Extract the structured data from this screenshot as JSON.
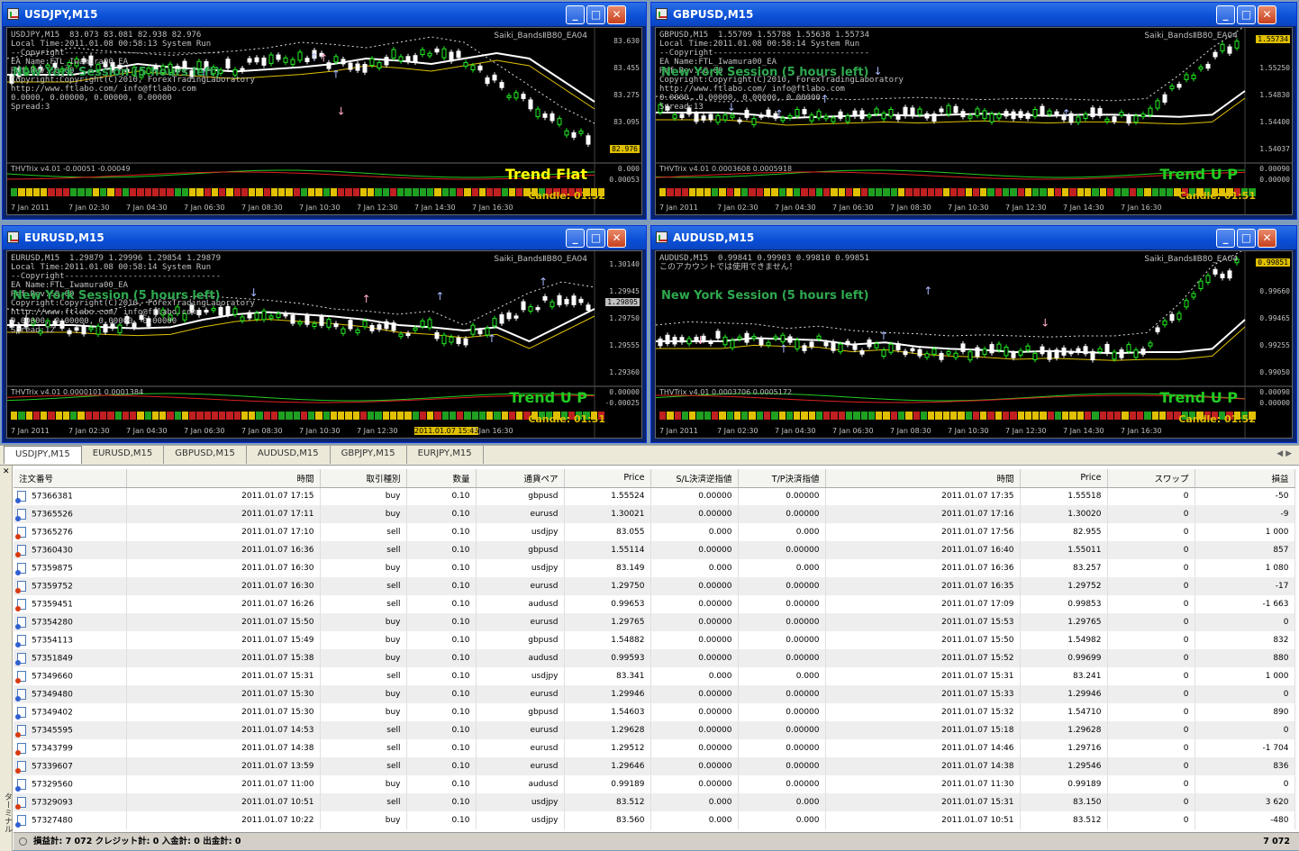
{
  "windows": [
    {
      "title": "USDJPY,M15",
      "info_lines": [
        "USDJPY,M15  83.073 83.081 82.938 82.976",
        "Local Time:2011.01.08 00:58:13 System Run",
        "--Copyright--------------------------------",
        "EA Name:FTL_Iwamura00_EA",
        "Ref.Rev.:0.00",
        "Copyright:Copyright(C)2010, ForexTradingLaboratory",
        "http://www.ftlabo.com/ info@ftlabo.com",
        "",
        "0.0000, 0.00000, 0.00000, 0.00000",
        "Spread:3"
      ],
      "ea_label": "Saiki_BandsⅡB80_EA04",
      "session": "New York Session (5 hours left)",
      "trend": "Trend Flat",
      "trend_up": false,
      "candle": "Candle:  01:52",
      "prices": [
        "83.630",
        "83.455",
        "83.275",
        "83.095",
        "82.920"
      ],
      "current_price": "82.976",
      "indicator": "THVTrix v4.01 -0.00051 -0.00049",
      "ind_values": [
        "0.000",
        "0.00053"
      ],
      "xaxis": [
        "7 Jan 2011",
        "7 Jan 02:30",
        "7 Jan 04:30",
        "7 Jan 06:30",
        "7 Jan 08:30",
        "7 Jan 10:30",
        "7 Jan 12:30",
        "7 Jan 14:30",
        "7 Jan 16:30"
      ]
    },
    {
      "title": "GBPUSD,M15",
      "info_lines": [
        "GBPUSD,M15  1.55709 1.55788 1.55638 1.55734",
        "Local Time:2011.01.08 00:58:14 System Run",
        "--Copyright--------------------------------",
        "EA Name:FTL_Iwamura00_EA",
        "Ref.Rev.:0.00",
        "Copyright:Copyright(C)2010, ForexTradingLaboratory",
        "http://www.ftlabo.com/ info@ftlabo.com",
        "",
        "0.0000, 0.00000, 0.00000, 0.00000",
        "Spread:13"
      ],
      "ea_label": "Saiki_BandsⅡB80_EA04",
      "session": "New York Session (5 hours left)",
      "trend": "Trend U P",
      "trend_up": true,
      "candle": "Candle:  01:51",
      "prices": [
        "1.55734",
        "1.55250",
        "1.54830",
        "1.54400",
        "1.54037"
      ],
      "current_price": "1.55734",
      "indicator": "THVTrix v4.01 0.0003608 0.0005918",
      "ind_values": [
        "0.00090",
        "0.00000"
      ],
      "xaxis": [
        "7 Jan 2011",
        "7 Jan 02:30",
        "7 Jan 04:30",
        "7 Jan 06:30",
        "7 Jan 08:30",
        "7 Jan 10:30",
        "7 Jan 12:30",
        "7 Jan 14:30",
        "7 Jan 16:30"
      ]
    },
    {
      "title": "EURUSD,M15",
      "info_lines": [
        "EURUSD,M15  1.29879 1.29996 1.29854 1.29879",
        "Local Time:2011.01.08 00:58:14 System Run",
        "--Copyright--------------------------------",
        "EA Name:FTL_Iwamura00_EA",
        "Ref.Rev.:0.00",
        "Copyright:Copyright(C)2010, ForexTradingLaboratory",
        "http://www.ftlabo.com/ info@ftlabo.com",
        "",
        "0.00000, 0.00000, 0.00000, 0.00000",
        "Spread:12"
      ],
      "ea_label": "Saiki_BandsⅡB80_EA04",
      "session": "New York Session (5 hours left)",
      "trend": "Trend U P",
      "trend_up": true,
      "candle": "Candle:  01:51",
      "prices": [
        "1.30140",
        "1.29945",
        "1.29750",
        "1.29555",
        "1.29360"
      ],
      "current_price": "1.29895",
      "indicator": "THVTrix v4.01 0.0000101 0.0001384",
      "ind_values": [
        "0.00000",
        "-0.00025"
      ],
      "xaxis": [
        "7 Jan 2011",
        "7 Jan 02:30",
        "7 Jan 04:30",
        "7 Jan 06:30",
        "7 Jan 08:30",
        "7 Jan 10:30",
        "7 Jan 12:30",
        "2011.01.07 15:45",
        "7 Jan 16:30"
      ]
    },
    {
      "title": "AUDUSD,M15",
      "info_lines": [
        "AUDUSD,M15  0.99841 0.99903 0.99810 0.99851",
        "このアカウントでは使用できません！"
      ],
      "ea_label": "Saiki_BandsⅡB80_EA04",
      "session": "New York Session (5 hours left)",
      "trend": "Trend U P",
      "trend_up": true,
      "candle": "Candle:  01:52",
      "prices": [
        "0.99851",
        "0.99660",
        "0.99465",
        "0.99255",
        "0.99050"
      ],
      "current_price": "0.99851",
      "indicator": "THVTrix v4.01 0.0003706 0.0005172",
      "ind_values": [
        "0.00090",
        "0.00000"
      ],
      "xaxis": [
        "7 Jan 2011",
        "7 Jan 02:30",
        "7 Jan 04:30",
        "7 Jan 06:30",
        "7 Jan 08:30",
        "7 Jan 10:30",
        "7 Jan 12:30",
        "7 Jan 14:30",
        "7 Jan 16:30"
      ]
    }
  ],
  "chart_tabs": [
    "USDJPY,M15",
    "EURUSD,M15",
    "GBPUSD,M15",
    "AUDUSD,M15",
    "GBPJPY,M15",
    "EURJPY,M15"
  ],
  "active_tab": "USDJPY,M15",
  "columns": [
    "注文番号",
    "時間",
    "取引種別",
    "数量",
    "通貨ペア",
    "Price",
    "S/L決済逆指値",
    "T/P決済指値",
    "時間",
    "Price",
    "スワップ",
    "損益"
  ],
  "rows": [
    [
      "57366381",
      "2011.01.07 17:15",
      "buy",
      "0.10",
      "gbpusd",
      "1.55524",
      "0.00000",
      "0.00000",
      "2011.01.07 17:35",
      "1.55518",
      "0",
      "-50"
    ],
    [
      "57365526",
      "2011.01.07 17:11",
      "buy",
      "0.10",
      "eurusd",
      "1.30021",
      "0.00000",
      "0.00000",
      "2011.01.07 17:16",
      "1.30020",
      "0",
      "-9"
    ],
    [
      "57365276",
      "2011.01.07 17:10",
      "sell",
      "0.10",
      "usdjpy",
      "83.055",
      "0.000",
      "0.000",
      "2011.01.07 17:56",
      "82.955",
      "0",
      "1 000"
    ],
    [
      "57360430",
      "2011.01.07 16:36",
      "sell",
      "0.10",
      "gbpusd",
      "1.55114",
      "0.00000",
      "0.00000",
      "2011.01.07 16:40",
      "1.55011",
      "0",
      "857"
    ],
    [
      "57359875",
      "2011.01.07 16:30",
      "buy",
      "0.10",
      "usdjpy",
      "83.149",
      "0.000",
      "0.000",
      "2011.01.07 16:36",
      "83.257",
      "0",
      "1 080"
    ],
    [
      "57359752",
      "2011.01.07 16:30",
      "sell",
      "0.10",
      "eurusd",
      "1.29750",
      "0.00000",
      "0.00000",
      "2011.01.07 16:35",
      "1.29752",
      "0",
      "-17"
    ],
    [
      "57359451",
      "2011.01.07 16:26",
      "sell",
      "0.10",
      "audusd",
      "0.99653",
      "0.00000",
      "0.00000",
      "2011.01.07 17:09",
      "0.99853",
      "0",
      "-1 663"
    ],
    [
      "57354280",
      "2011.01.07 15:50",
      "buy",
      "0.10",
      "eurusd",
      "1.29765",
      "0.00000",
      "0.00000",
      "2011.01.07 15:53",
      "1.29765",
      "0",
      "0"
    ],
    [
      "57354113",
      "2011.01.07 15:49",
      "buy",
      "0.10",
      "gbpusd",
      "1.54882",
      "0.00000",
      "0.00000",
      "2011.01.07 15:50",
      "1.54982",
      "0",
      "832"
    ],
    [
      "57351849",
      "2011.01.07 15:38",
      "buy",
      "0.10",
      "audusd",
      "0.99593",
      "0.00000",
      "0.00000",
      "2011.01.07 15:52",
      "0.99699",
      "0",
      "880"
    ],
    [
      "57349660",
      "2011.01.07 15:31",
      "sell",
      "0.10",
      "usdjpy",
      "83.341",
      "0.000",
      "0.000",
      "2011.01.07 15:31",
      "83.241",
      "0",
      "1 000"
    ],
    [
      "57349480",
      "2011.01.07 15:30",
      "buy",
      "0.10",
      "eurusd",
      "1.29946",
      "0.00000",
      "0.00000",
      "2011.01.07 15:33",
      "1.29946",
      "0",
      "0"
    ],
    [
      "57349402",
      "2011.01.07 15:30",
      "buy",
      "0.10",
      "gbpusd",
      "1.54603",
      "0.00000",
      "0.00000",
      "2011.01.07 15:32",
      "1.54710",
      "0",
      "890"
    ],
    [
      "57345595",
      "2011.01.07 14:53",
      "sell",
      "0.10",
      "eurusd",
      "1.29628",
      "0.00000",
      "0.00000",
      "2011.01.07 15:18",
      "1.29628",
      "0",
      "0"
    ],
    [
      "57343799",
      "2011.01.07 14:38",
      "sell",
      "0.10",
      "eurusd",
      "1.29512",
      "0.00000",
      "0.00000",
      "2011.01.07 14:46",
      "1.29716",
      "0",
      "-1 704"
    ],
    [
      "57339607",
      "2011.01.07 13:59",
      "sell",
      "0.10",
      "eurusd",
      "1.29646",
      "0.00000",
      "0.00000",
      "2011.01.07 14:38",
      "1.29546",
      "0",
      "836"
    ],
    [
      "57329560",
      "2011.01.07 11:00",
      "buy",
      "0.10",
      "audusd",
      "0.99189",
      "0.00000",
      "0.00000",
      "2011.01.07 11:30",
      "0.99189",
      "0",
      "0"
    ],
    [
      "57329093",
      "2011.01.07 10:51",
      "sell",
      "0.10",
      "usdjpy",
      "83.512",
      "0.000",
      "0.000",
      "2011.01.07 15:31",
      "83.150",
      "0",
      "3 620"
    ],
    [
      "57327480",
      "2011.01.07 10:22",
      "buy",
      "0.10",
      "usdjpy",
      "83.560",
      "0.000",
      "0.000",
      "2011.01.07 10:51",
      "83.512",
      "0",
      "-480"
    ]
  ],
  "summary": "損益計: 7 072  クレジット計: 0  入金計: 0  出金計: 0",
  "summary_total": "7 072",
  "terminal_label": "ターミナル",
  "colors": {
    "chart_bg": "#000000",
    "bull": "#22ee22",
    "bear": "#ffffff",
    "trend_flat": "#ffff00",
    "trend_up": "#22cc22",
    "session": "#2ea84e"
  }
}
